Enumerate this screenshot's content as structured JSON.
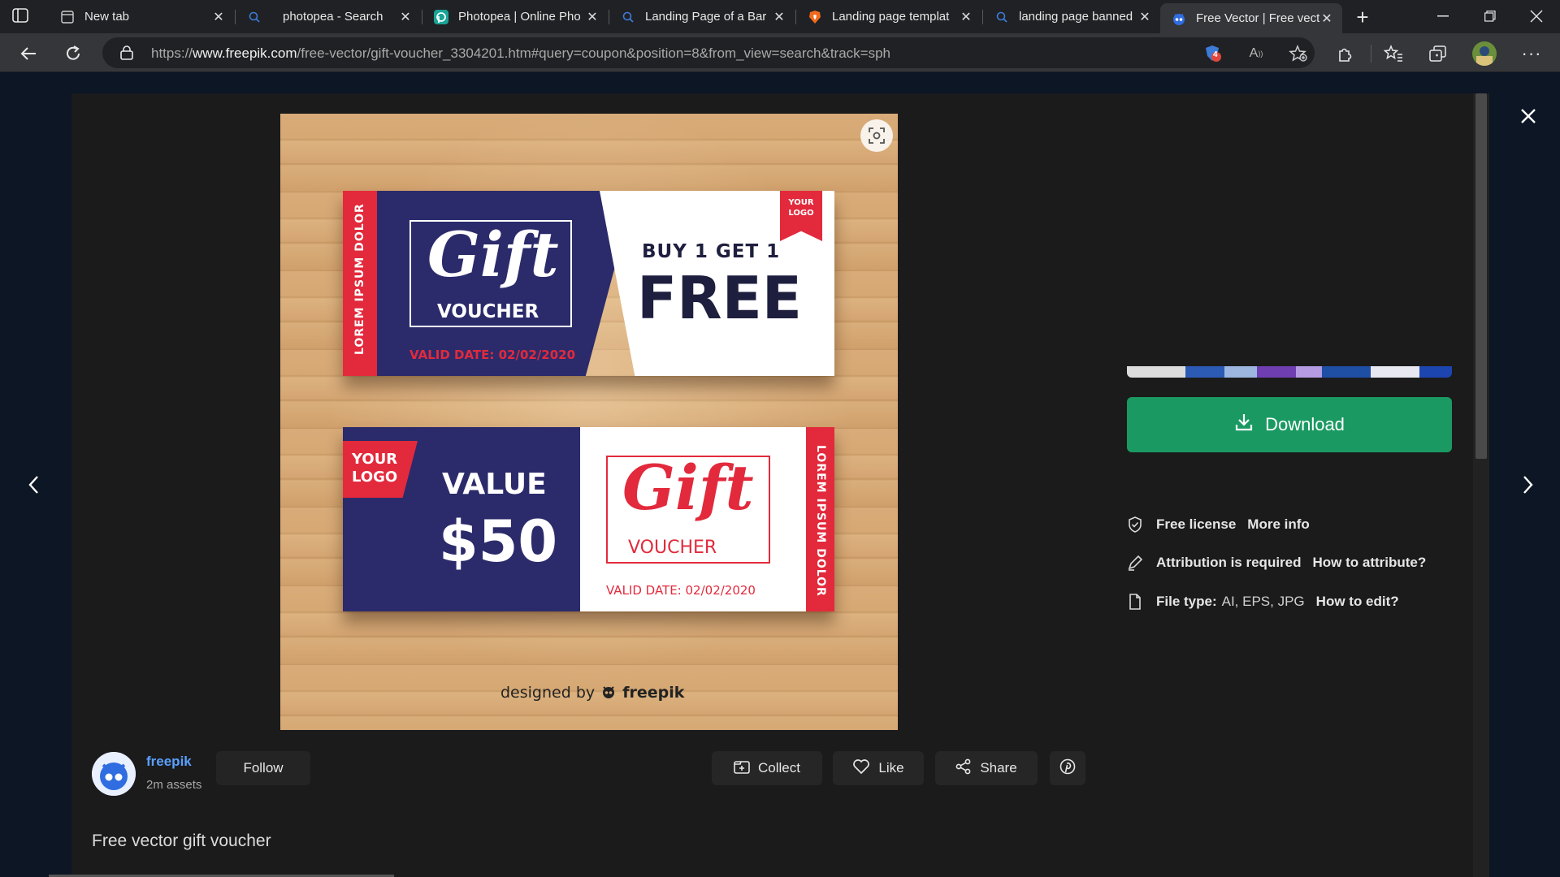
{
  "browser": {
    "tabs": [
      {
        "title": "New tab",
        "icon": "newtab-icon"
      },
      {
        "title": "photopea - Search",
        "icon": "search-icon"
      },
      {
        "title": "Photopea | Online Pho",
        "icon": "photopea-icon"
      },
      {
        "title": "Landing Page of a Bar",
        "icon": "search-icon"
      },
      {
        "title": "Landing page templat",
        "icon": "brave-icon"
      },
      {
        "title": "landing page banned",
        "icon": "search-icon"
      },
      {
        "title": "Free Vector | Free vect",
        "icon": "freepik-icon",
        "active": true
      }
    ],
    "url": {
      "prefix": "https://",
      "domain": "www.freepik.com",
      "path": "/free-vector/gift-voucher_3304201.htm#query=coupon&position=8&from_view=search&track=sph"
    },
    "extension_badge": "4"
  },
  "artwork": {
    "voucher1": {
      "side_text": "LOREM IPSUM DOLOR",
      "gift": "Gift",
      "voucher": "VOUCHER",
      "valid": "VALID DATE: 02/02/2020",
      "buy": "BUY 1 GET 1",
      "free": "FREE",
      "logo_line1": "YOUR",
      "logo_line2": "LOGO"
    },
    "voucher2": {
      "logo_line1": "YOUR",
      "logo_line2": "LOGO",
      "value_label": "VALUE",
      "value": "$50",
      "gift": "Gift",
      "voucher": "VOUCHER",
      "valid": "VALID DATE: 02/02/2020",
      "side_text": "LOREM IPSUM DOLOR"
    },
    "credit_prefix": "designed by",
    "credit_brand": "freepik",
    "colors": {
      "navy": "#2b2b6b",
      "red": "#e22a3c",
      "white": "#ffffff"
    }
  },
  "panel": {
    "download_label": "Download",
    "license": {
      "label": "Free license",
      "link": "More info"
    },
    "attribution": {
      "label": "Attribution is required",
      "link": "How to attribute?"
    },
    "filetype": {
      "label": "File type:",
      "value": "AI, EPS, JPG",
      "link": "How to edit?"
    }
  },
  "author": {
    "name": "freepik",
    "assets": "2m assets",
    "follow_label": "Follow"
  },
  "actions": {
    "collect": "Collect",
    "like": "Like",
    "share": "Share"
  },
  "asset_title": "Free vector gift voucher",
  "colors": {
    "download": "#1a9a62",
    "author_link": "#5aa0ff",
    "modal_bg": "#1b1b1c"
  }
}
